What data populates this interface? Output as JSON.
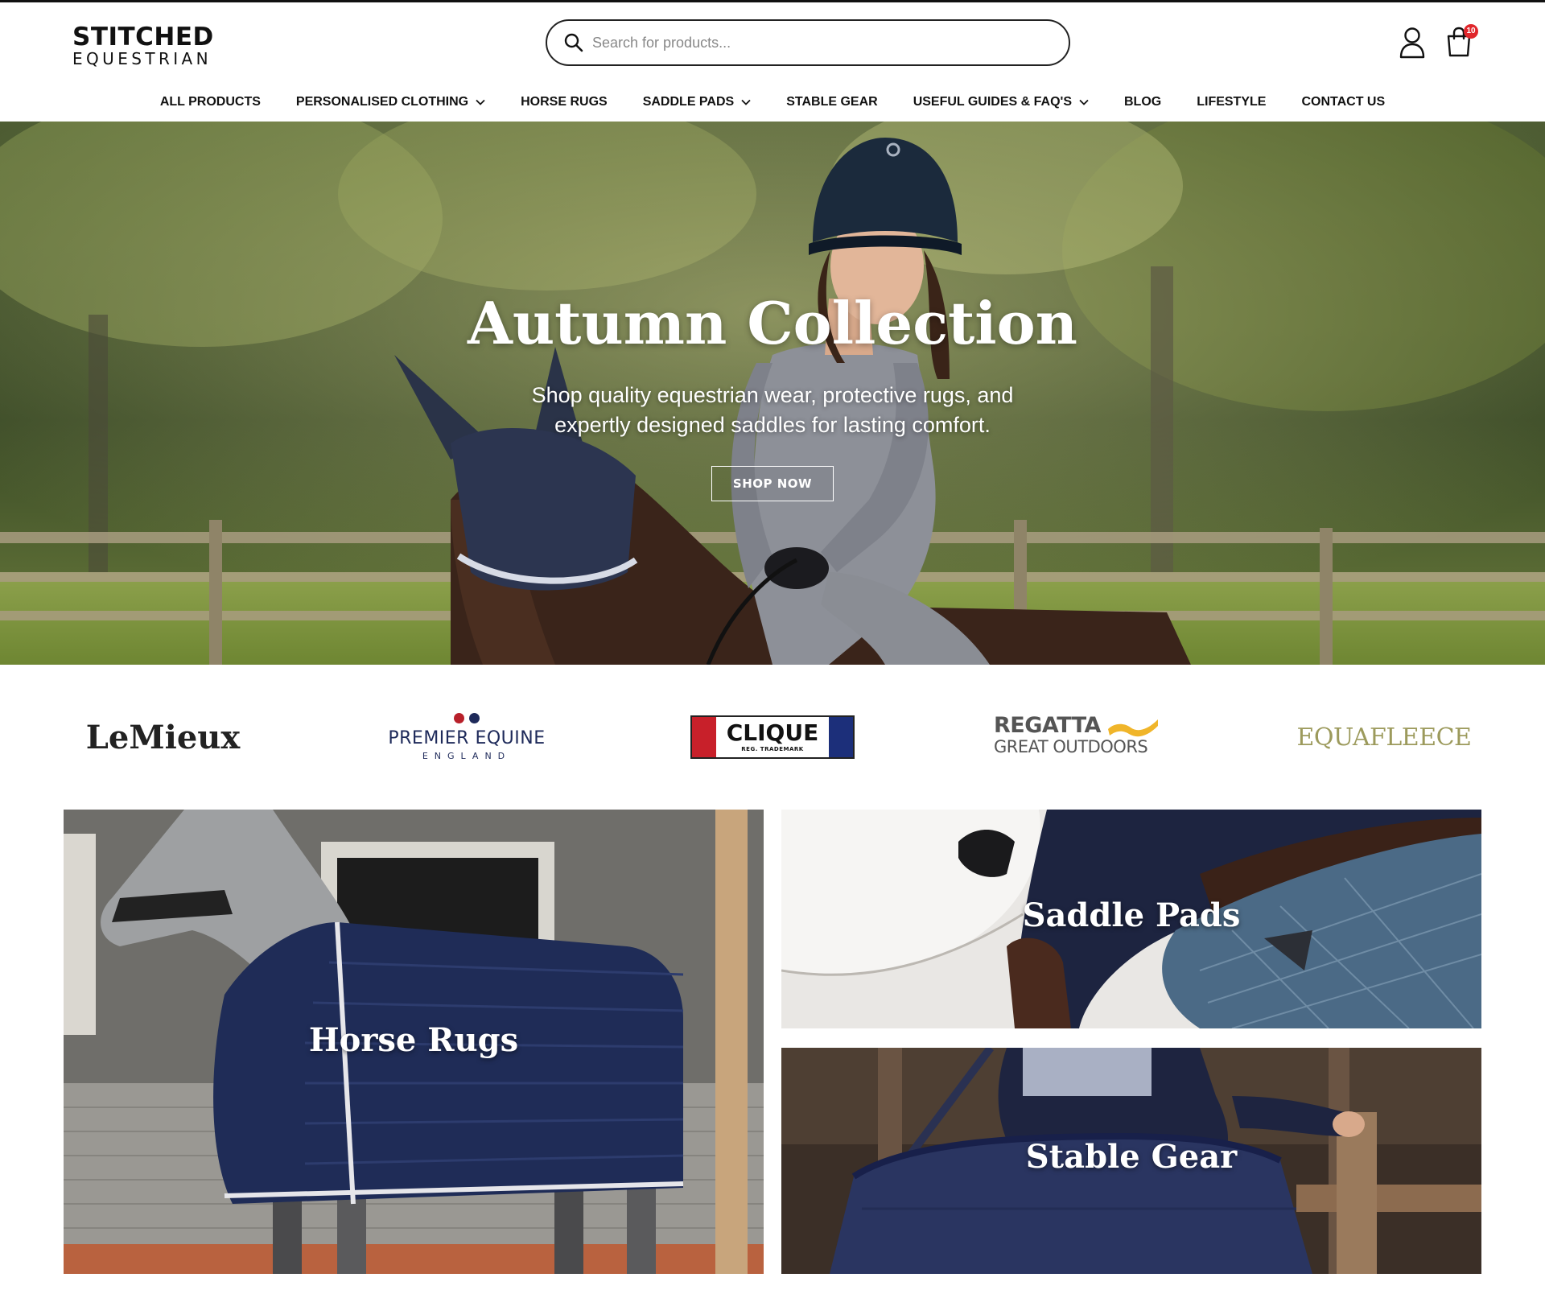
{
  "brand": {
    "logo_top": "STITCHED",
    "logo_bottom": "EQUESTRIAN"
  },
  "search": {
    "placeholder": "Search for products..."
  },
  "cart": {
    "count": "10"
  },
  "nav": [
    {
      "label": "ALL PRODUCTS",
      "dropdown": false
    },
    {
      "label": "PERSONALISED CLOTHING",
      "dropdown": true
    },
    {
      "label": "HORSE RUGS",
      "dropdown": false
    },
    {
      "label": "SADDLE PADS",
      "dropdown": true
    },
    {
      "label": "STABLE GEAR",
      "dropdown": false
    },
    {
      "label": "USEFUL GUIDES & FAQ'S",
      "dropdown": true
    },
    {
      "label": "BLOG",
      "dropdown": false
    },
    {
      "label": "LIFESTYLE",
      "dropdown": false
    },
    {
      "label": "CONTACT US",
      "dropdown": false
    }
  ],
  "hero": {
    "title": "Autumn Collection",
    "subtitle": "Shop quality equestrian wear, protective rugs, and expertly designed saddles for lasting comfort.",
    "button": "SHOP NOW"
  },
  "brands": {
    "lemieux": "LeMieux",
    "premier_name": "PREMIER EQUINE",
    "premier_sub": "ENGLAND",
    "clique_name": "CLIQUE",
    "clique_tm": "REG. TRADEMARK",
    "regatta_name": "REGATTA",
    "regatta_sub": "GREAT OUTDOORS",
    "equafleece": "EQUAFLEECE"
  },
  "categories": {
    "horse_rugs": "Horse Rugs",
    "saddle_pads": "Saddle Pads",
    "stable_gear": "Stable Gear"
  },
  "colors": {
    "cart_badge": "#e0262b",
    "rug_navy": "#1f2c57",
    "pad_blue": "#4b6a86",
    "equafleece_olive": "#9c9a5c"
  }
}
